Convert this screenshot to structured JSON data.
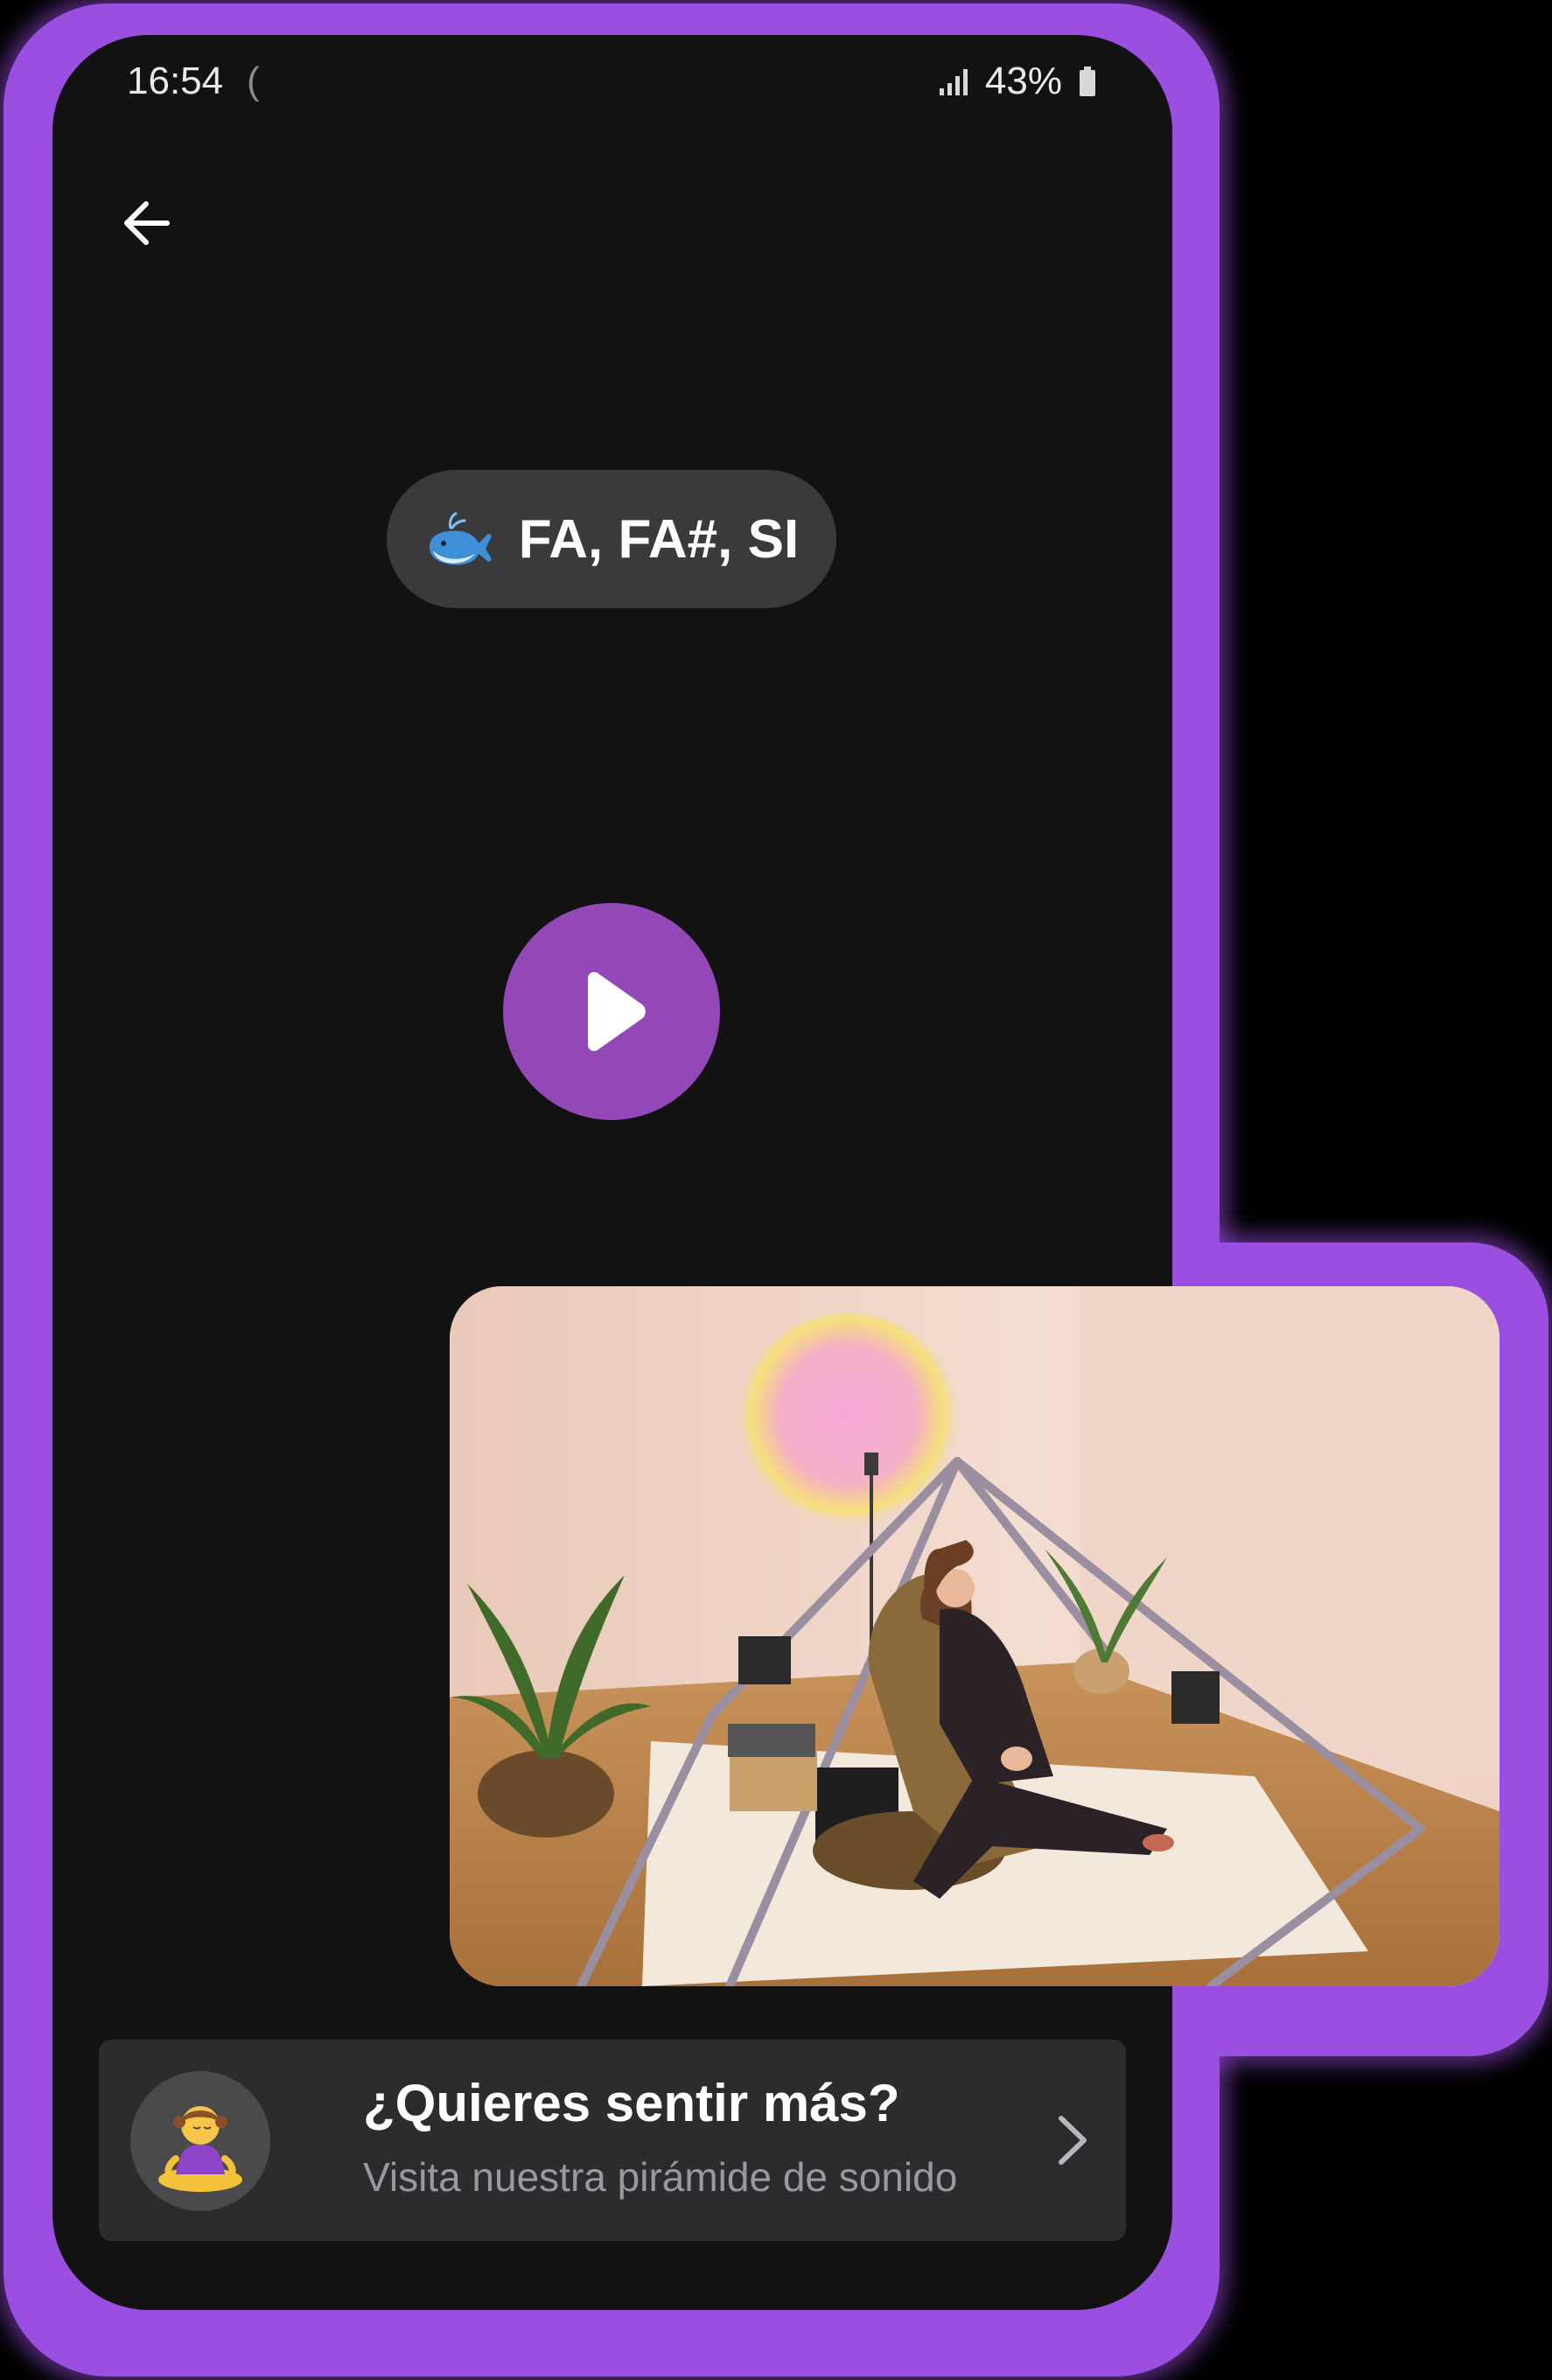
{
  "status_bar": {
    "time": "16:54",
    "notification_glyph": "(",
    "battery": "43%",
    "signal_icon": "signal-icon",
    "battery_icon": "battery-icon"
  },
  "toolbar": {
    "back_icon": "back-arrow-icon"
  },
  "note_pill": {
    "emoji_icon": "whale-icon",
    "label": "FA, FA#, SI"
  },
  "player": {
    "play_icon": "play-icon",
    "accent_color": "#9448b8"
  },
  "cta": {
    "avatar_icon": "meditating-person-icon",
    "title": "¿Quieres sentir más?",
    "subtitle": "Visita nuestra pirámide de sonido",
    "chevron_icon": "chevron-right-icon"
  },
  "photo": {
    "subject": "sound-pyramid-photo"
  },
  "colors": {
    "frame": "#9a4fe0",
    "background": "#121213",
    "pill": "#3a3a3c",
    "card": "#2c2c2e"
  }
}
